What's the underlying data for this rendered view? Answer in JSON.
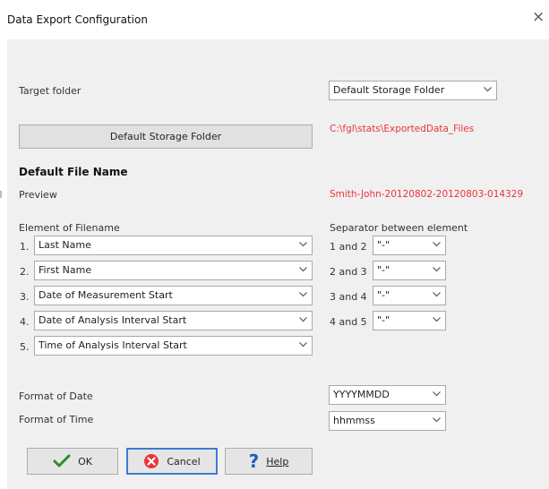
{
  "window": {
    "title": "Data Export Configuration",
    "close_glyph": "×"
  },
  "target_folder": {
    "label": "Target folder",
    "dropdown_value": "Default Storage Folder",
    "button_label": "Default Storage Folder",
    "path": "C:\\fgl\\stats\\ExportedData_Files"
  },
  "default_file_name": {
    "heading": "Default File Name",
    "preview_label": "Preview",
    "preview_value": "Smith-John-20120802-20120803-014329"
  },
  "elements": {
    "label": "Element of Filename",
    "items": [
      {
        "num": "1.",
        "value": "Last Name"
      },
      {
        "num": "2.",
        "value": "First Name"
      },
      {
        "num": "3.",
        "value": "Date of Measurement Start"
      },
      {
        "num": "4.",
        "value": "Date of Analysis Interval Start"
      },
      {
        "num": "5.",
        "value": "Time of Analysis Interval Start"
      }
    ]
  },
  "separators": {
    "label": "Separator between element",
    "items": [
      {
        "label": "1 and 2",
        "value": "\"-\""
      },
      {
        "label": "2 and 3",
        "value": "\"-\""
      },
      {
        "label": "3 and 4",
        "value": "\"-\""
      },
      {
        "label": "4 and 5",
        "value": "\"-\""
      }
    ]
  },
  "format_date": {
    "label": "Format of Date",
    "value": "YYYYMMDD"
  },
  "format_time": {
    "label": "Format of Time",
    "value": "hhmmss"
  },
  "buttons": {
    "ok": "OK",
    "cancel": "Cancel",
    "help": "Help"
  },
  "colors": {
    "accent_red": "#e8343b",
    "focus_blue": "#3d7bd4",
    "check_green": "#2e8b2e",
    "help_blue": "#1f5fbf"
  },
  "icons": [
    "close-icon",
    "chevron-down-icon",
    "checkmark-icon",
    "cancel-x-icon",
    "question-mark-icon"
  ]
}
